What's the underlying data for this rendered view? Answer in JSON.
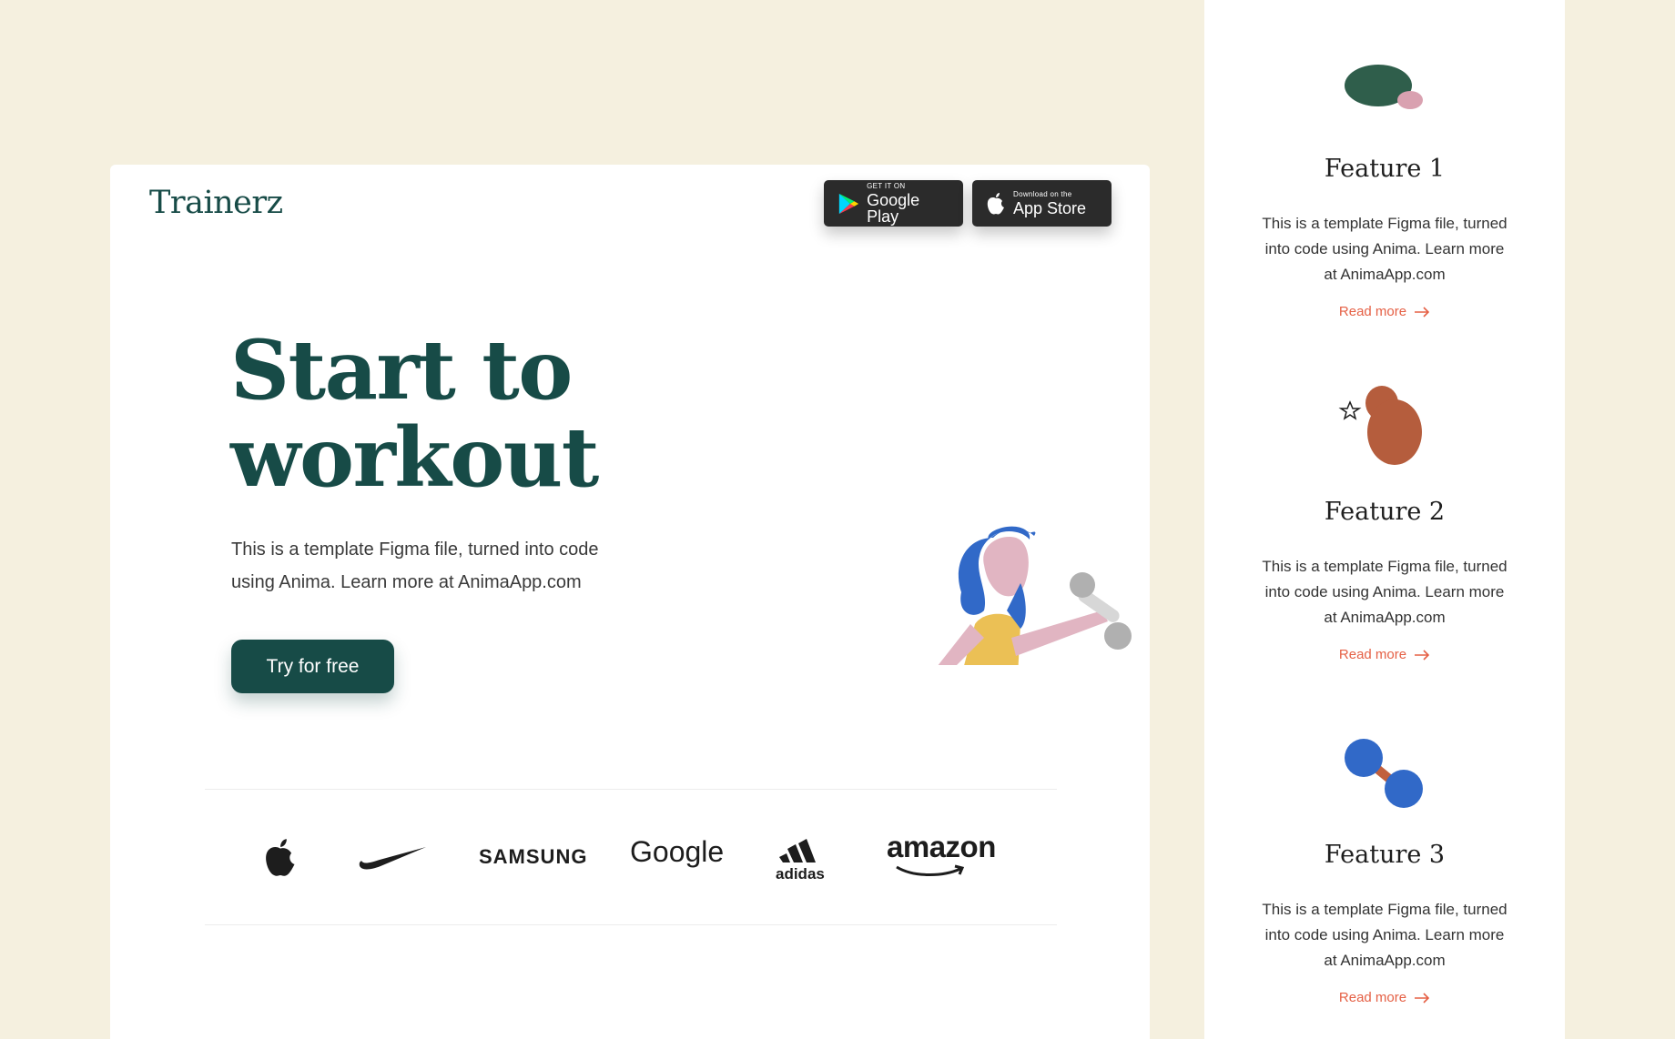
{
  "brand": {
    "name": "Trainerz"
  },
  "stores": {
    "google_play": {
      "small": "GET IT ON",
      "big": "Google Play"
    },
    "app_store": {
      "small": "Download on the",
      "big": "App Store"
    }
  },
  "hero": {
    "title_line1": "Start to",
    "title_line2": "workout",
    "description": "This is a template Figma file, turned into code using Anima. Learn more at AnimaApp.com",
    "cta_label": "Try for free"
  },
  "logos": {
    "items": [
      "apple-logo",
      "nike-logo",
      "samsung-logo",
      "google-logo",
      "adidas-logo",
      "amazon-logo"
    ],
    "samsung": "SAMSUNG",
    "google": "Google",
    "adidas": "adidas",
    "amazon": "amazon"
  },
  "features": [
    {
      "title": "Feature 1",
      "description": "This is a template Figma file, turned into code using Anima. Learn more at AnimaApp.com",
      "link": "Read more"
    },
    {
      "title": "Feature 2",
      "description": "This is a template Figma file, turned into code using Anima. Learn more at AnimaApp.com",
      "link": "Read more"
    },
    {
      "title": "Feature 3",
      "description": "This is a template Figma file, turned into code using Anima. Learn more at AnimaApp.com",
      "link": "Read more"
    }
  ],
  "colors": {
    "background": "#f5f0df",
    "brand": "#174b47",
    "accent": "#e56045",
    "card": "#ffffff"
  }
}
